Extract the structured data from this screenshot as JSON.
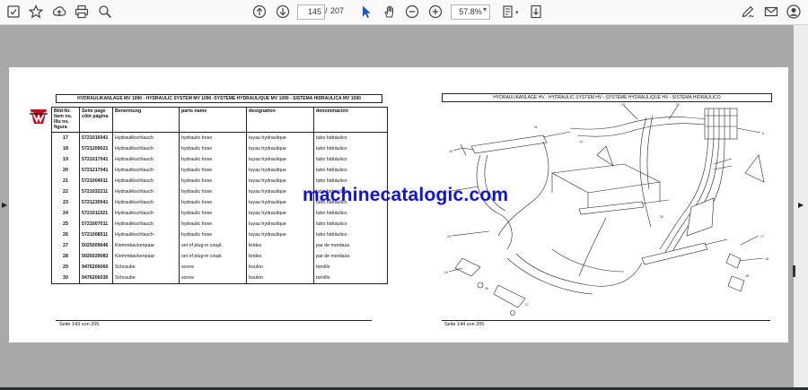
{
  "toolbar": {
    "current_page": "145",
    "page_separator": "/",
    "total_pages": "207",
    "zoom": "57.8%"
  },
  "page_left": {
    "header": "HYDRAULIKANLAGE MV 1090 - HYDRAULIC SYSTEM MV 1090 -SYSTEME HYDRAULIQUE MV 1090 - SISTEMA HIDRAULICA MV 1090",
    "columns": [
      "Bild-Nr. Item no. Illu no. figura",
      "Seite page côté página",
      "Benennung",
      "parts name",
      "designation",
      "denominación"
    ],
    "rows": [
      [
        "17",
        "5721016041",
        "Hydraulikschlauch",
        "hydraulic hose",
        "tuyau hydraulique",
        "tubo hidráulico"
      ],
      [
        "18",
        "5721209021",
        "Hydraulikschlauch",
        "hydraulic hose",
        "tuyau hydraulique",
        "tubo hidráulico"
      ],
      [
        "19",
        "5721017041",
        "Hydraulikschlauch",
        "hydraulic hose",
        "tuyau hydraulique",
        "tubo hidráulico"
      ],
      [
        "20",
        "5721217041",
        "Hydraulikschlauch",
        "hydraulic hose",
        "tuyau hydraulique",
        "tubo hidráulico"
      ],
      [
        "21",
        "5721004011",
        "Hydraulikschlauch",
        "hydraulic hose",
        "tuyau hydraulique",
        "tubo hidráulico"
      ],
      [
        "22",
        "5721032211",
        "Hydraulikschlauch",
        "hydraulic hose",
        "tuyau hydraulique",
        "tubo hidráulico"
      ],
      [
        "23",
        "5721230041",
        "Hydraulikschlauch",
        "hydraulic hose",
        "tuyau hydraulique",
        "tubo hidráulico"
      ],
      [
        "24",
        "5721011021",
        "Hydraulikschlauch",
        "hydraulic hose",
        "tuyau hydraulique",
        "tubo hidráulico"
      ],
      [
        "25",
        "5721007011",
        "Hydraulikschlauch",
        "hydraulic hose",
        "tuyau hydraulique",
        "tubo hidráulico"
      ],
      [
        "26",
        "5721008511",
        "Hydraulikschlauch",
        "hydraulic hose",
        "tuyau hydraulique",
        "tubo hidráulico"
      ],
      [
        "27",
        "5025009646",
        "Klemmbackenpaar",
        "set of plug-in coupl.",
        "brides",
        "par de mordaza"
      ],
      [
        "28",
        "5025029083",
        "Klemmbackenpaar",
        "set of plug-in coupl.",
        "brides",
        "par de mordaza"
      ],
      [
        "29",
        "9476206060",
        "Schraube",
        "screw",
        "boulon",
        "tornillo"
      ],
      [
        "30",
        "9476206030",
        "Schraube",
        "screw",
        "boulon",
        "tornillo"
      ]
    ],
    "footer": "Seite 143 von 205"
  },
  "page_right": {
    "header": "HYDRAULIKANLAGE HV - HYDRAULIC SYSTEM HV - SYSTEME HYDRAULIQUE HV - SISTEMA HIDRAULICO",
    "footer": "Seite 144 von 205"
  },
  "watermark": "machinecatalogic.com",
  "colors": {
    "viewer_background": "#a9a9a9",
    "toolbar_background": "#f9f9fa",
    "watermark": "#1010e6",
    "logo_red": "#d0021b"
  },
  "icons": [
    "bookmark-icon",
    "star-icon",
    "upload-icon",
    "print-icon",
    "zoom-search-icon",
    "page-up-icon",
    "page-down-icon",
    "select-cursor-icon",
    "hand-tool-icon",
    "zoom-out-icon",
    "zoom-in-icon",
    "fit-page-icon",
    "scroll-mode-icon",
    "sign-icon",
    "email-icon",
    "account-icon"
  ]
}
